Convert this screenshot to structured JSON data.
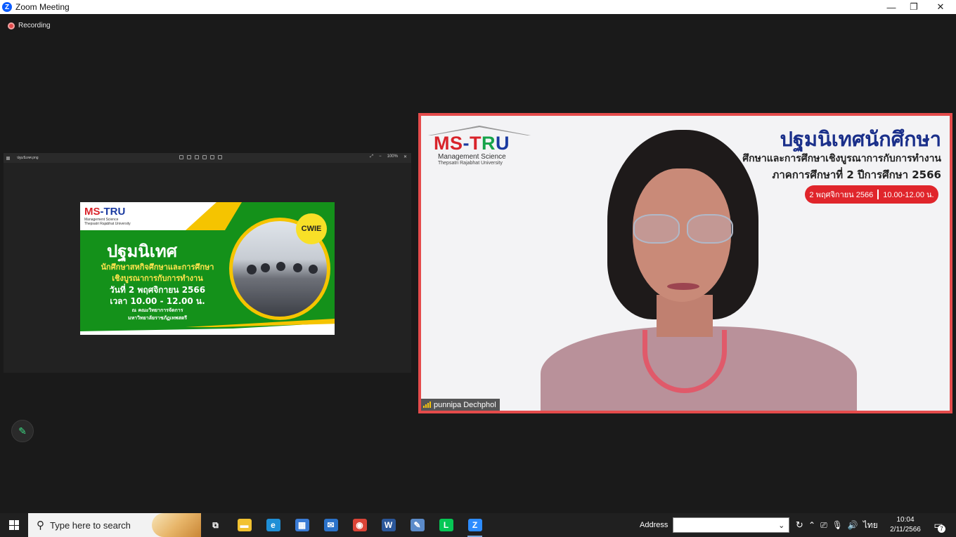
{
  "window": {
    "title": "Zoom Meeting",
    "app_icon": "zoom-logo-icon",
    "controls": [
      "minimize-icon",
      "maximize-icon",
      "close-icon"
    ]
  },
  "recording": {
    "label": "Recording",
    "color": "#e04b4b"
  },
  "shared_screen": {
    "file_name": "ปฐมนิเทศ.png",
    "zoom_level": "100%",
    "banner": {
      "logo_ms": "MS",
      "logo_tru": "-TRU",
      "logo_sub1": "Management Science",
      "logo_sub2": "Thepsatri Rajabhat University",
      "title": "ปฐมนิเทศ",
      "line1": "นักศึกษาสหกิจศึกษาและการศึกษา",
      "line2": "เชิงบูรณาการกับการทำงาน",
      "date": "วันที่ 2 พฤศจิกายน 2566",
      "time": "เวลา 10.00 - 12.00 น.",
      "venue1": "ณ คณะวิทยาการจัดการ",
      "venue2": "มหาวิทยาลัยราชภัฏเทพสตรี",
      "badge": "CWIE"
    }
  },
  "speaker_video": {
    "border_color": "#e54b4b",
    "logo_ms": "MS",
    "logo_dash": "-",
    "logo_t": "T",
    "logo_r": "R",
    "logo_u": "U",
    "logo_sub1": "Management Science",
    "logo_sub2": "Thepsatri Rajabhat University",
    "title": "ปฐมนิเทศนักศึกษา",
    "line2": "ศึกษาและการศึกษาเชิงบูรณาการกับการทำงาน",
    "line3": "ภาคการศึกษาที่ 2 ปีการศึกษา 2566",
    "pill_date": "2 พฤศจิกายน 2566",
    "pill_time": "10.00-12.00 น.",
    "participant_name": "punnipa Dechphol"
  },
  "annotate": {
    "icon": "pencil-icon"
  },
  "taskbar": {
    "search_placeholder": "Type here to search",
    "apps": [
      {
        "name": "task-view",
        "icon": "task-view-icon",
        "glyph": "⧉",
        "color": "#202020"
      },
      {
        "name": "file-explorer",
        "icon": "folder-icon",
        "glyph": "▬",
        "color": "#f2c230"
      },
      {
        "name": "edge",
        "icon": "edge-icon",
        "glyph": "e",
        "color": "#1f8fd6"
      },
      {
        "name": "store",
        "icon": "store-icon",
        "glyph": "▦",
        "color": "#3a7bd5"
      },
      {
        "name": "mail",
        "icon": "mail-icon",
        "glyph": "✉",
        "color": "#2b72c9"
      },
      {
        "name": "chrome",
        "icon": "chrome-icon",
        "glyph": "◉",
        "color": "#db4437"
      },
      {
        "name": "word",
        "icon": "word-icon",
        "glyph": "W",
        "color": "#2b579a"
      },
      {
        "name": "writer",
        "icon": "writer-icon",
        "glyph": "✎",
        "color": "#5b8bc9"
      },
      {
        "name": "line",
        "icon": "line-icon",
        "glyph": "L",
        "color": "#06c755"
      },
      {
        "name": "zoom",
        "icon": "zoom-icon",
        "glyph": "Z",
        "color": "#2d8cff"
      }
    ],
    "address_label": "Address",
    "address_value": "",
    "tray_lang": "ไทย",
    "clock_time": "10:04",
    "clock_date": "2/11/2566",
    "notification_count": "7"
  }
}
